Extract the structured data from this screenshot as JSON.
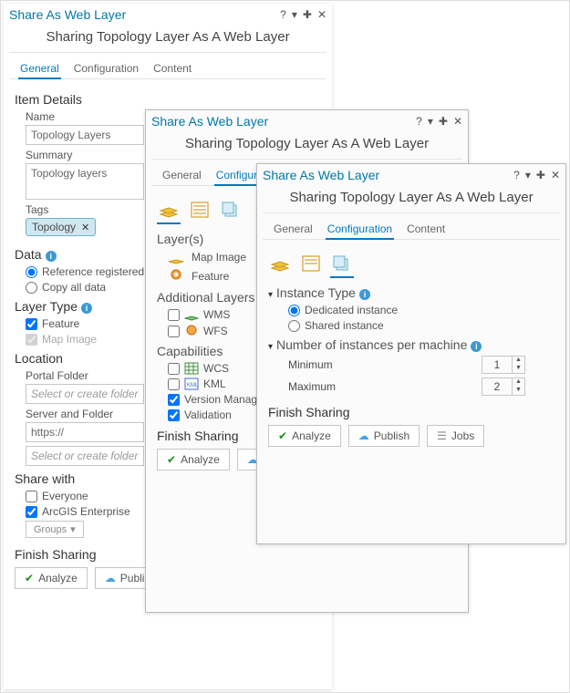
{
  "common": {
    "window_title": "Share As Web Layer",
    "subtitle": "Sharing Topology Layer As A Web Layer",
    "tabs": {
      "general": "General",
      "configuration": "Configuration",
      "content": "Content"
    },
    "finish": {
      "heading": "Finish Sharing",
      "analyze": "Analyze",
      "publish": "Publish",
      "jobs": "Jobs"
    }
  },
  "panel1": {
    "item_details": "Item Details",
    "name_label": "Name",
    "name_value": "Topology Layers",
    "summary_label": "Summary",
    "summary_value": "Topology layers",
    "tags_label": "Tags",
    "tag": "Topology",
    "data_heading": "Data",
    "radio_ref": "Reference registered",
    "radio_copy": "Copy all data",
    "layer_type": "Layer Type",
    "chk_feature": "Feature",
    "chk_mapimage": "Map Image",
    "location": "Location",
    "portal_folder": "Portal Folder",
    "portal_placeholder": "Select or create folder",
    "server_folder": "Server and Folder",
    "server_value": "https://",
    "server_placeholder": "Select or create folder",
    "share_with": "Share with",
    "chk_everyone": "Everyone",
    "chk_enterprise": "ArcGIS Enterprise",
    "groups": "Groups"
  },
  "panel2": {
    "layers_heading": "Layer(s)",
    "map_image": "Map Image",
    "feature": "Feature",
    "addl": "Additional Layers",
    "wms": "WMS",
    "wfs": "WFS",
    "caps": "Capabilities",
    "wcs": "WCS",
    "kml": "KML",
    "vm": "Version Management",
    "validation": "Validation"
  },
  "panel3": {
    "instance_type": "Instance Type",
    "dedicated": "Dedicated instance",
    "shared": "Shared instance",
    "num_instances": "Number of instances per machine",
    "min_label": "Minimum",
    "min_val": "1",
    "max_label": "Maximum",
    "max_val": "2"
  }
}
